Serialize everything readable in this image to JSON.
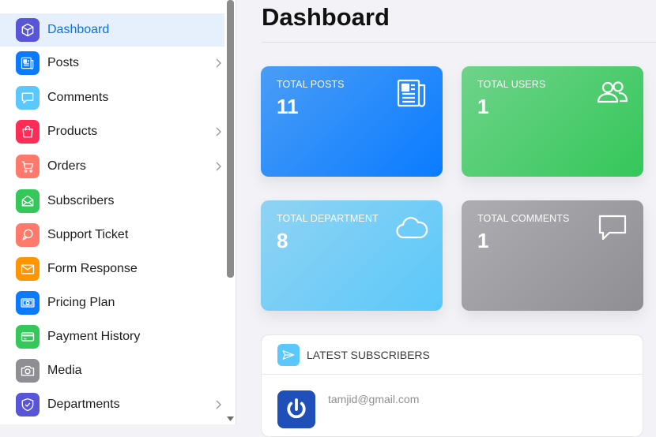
{
  "sidebar": {
    "items": [
      {
        "label": "Dashboard",
        "icon": "cube-icon",
        "color": "#5856d6",
        "active": true,
        "has_chevron": false
      },
      {
        "label": "Posts",
        "icon": "newspaper-icon",
        "color": "#0a7bff",
        "active": false,
        "has_chevron": true
      },
      {
        "label": "Comments",
        "icon": "chat-bubble-icon",
        "color": "#5ac8fa",
        "active": false,
        "has_chevron": false
      },
      {
        "label": "Products",
        "icon": "shopping-bag-icon",
        "color": "#ff2d55",
        "active": false,
        "has_chevron": true
      },
      {
        "label": "Orders",
        "icon": "cart-icon",
        "color": "#ff7a6b",
        "active": false,
        "has_chevron": true
      },
      {
        "label": "Subscribers",
        "icon": "mail-open-icon",
        "color": "#34c759",
        "active": false,
        "has_chevron": false
      },
      {
        "label": "Support Ticket",
        "icon": "support-bubble-icon",
        "color": "#ff7a6b",
        "active": false,
        "has_chevron": false
      },
      {
        "label": "Form Response",
        "icon": "envelope-icon",
        "color": "#ff9500",
        "active": false,
        "has_chevron": false
      },
      {
        "label": "Pricing Plan",
        "icon": "money-icon",
        "color": "#0a7bff",
        "active": false,
        "has_chevron": false
      },
      {
        "label": "Payment History",
        "icon": "credit-card-icon",
        "color": "#34c759",
        "active": false,
        "has_chevron": false
      },
      {
        "label": "Media",
        "icon": "camera-icon",
        "color": "#8e8e93",
        "active": false,
        "has_chevron": false
      },
      {
        "label": "Departments",
        "icon": "shield-check-icon",
        "color": "#5856d6",
        "active": false,
        "has_chevron": true
      }
    ]
  },
  "main": {
    "title": "Dashboard",
    "cards": [
      {
        "label": "TOTAL POSTS",
        "value": "11",
        "icon": "newspaper-icon"
      },
      {
        "label": "TOTAL USERS",
        "value": "1",
        "icon": "users-icon"
      },
      {
        "label": "TOTAL DEPARTMENT",
        "value": "8",
        "icon": "cloud-icon"
      },
      {
        "label": "TOTAL COMMENTS",
        "value": "1",
        "icon": "chat-bubble-icon"
      }
    ],
    "latest_subscribers": {
      "title": "LATEST SUBSCRIBERS",
      "items": [
        {
          "email": "tamjid@gmail.com"
        }
      ]
    }
  }
}
